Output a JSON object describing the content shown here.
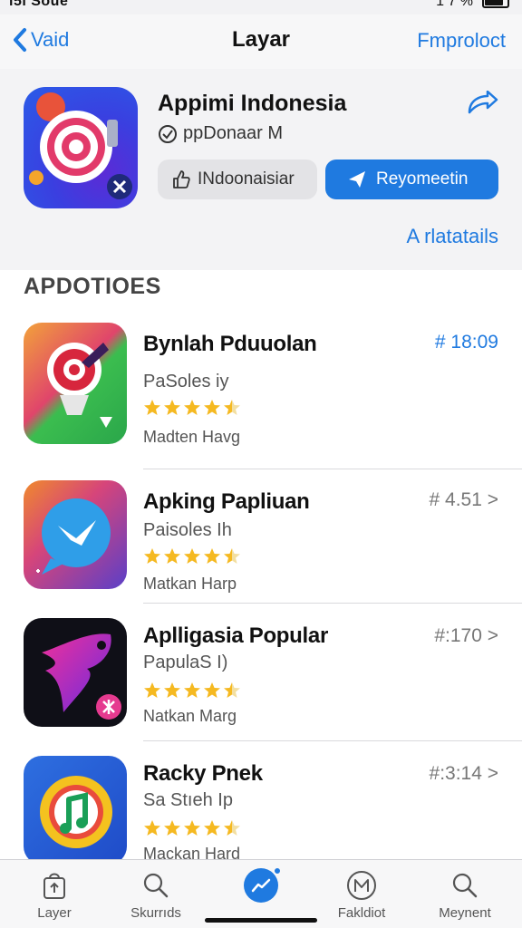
{
  "status_bar": {
    "left_text": "ı5ı Soue",
    "right_text": "1 7 %"
  },
  "nav": {
    "back_label": "Vaid",
    "title": "Layar",
    "right_label": "Fmproloct"
  },
  "hero": {
    "app_title": "Appimi Indonesia",
    "subtitle": "ppDonaar M",
    "secondary_button": "INdoonaisiar",
    "primary_button": "Reyomeetin",
    "link": "A rlatatails"
  },
  "section": {
    "title": "APDOTIOES"
  },
  "apps": [
    {
      "name": "Bynlah Pduuolan",
      "sub": "PaSoles iy",
      "seller": "Madten Havg",
      "price": "# 18:09",
      "rating": 4.5
    },
    {
      "name": "Apking Papliuan",
      "sub": "Paisoles Ih",
      "seller": "Matkan Harp",
      "price": "# 4.51 >",
      "rating": 4.5
    },
    {
      "name": "Aplligasia Popular",
      "sub": "PapulaS I)",
      "seller": "Natkan Marg",
      "price": "#:170 >",
      "rating": 4.5
    },
    {
      "name": "Racky Pnek",
      "sub": "Sa Stıeh Ip",
      "seller": "Mackan Hard",
      "price": "#:3:14 >",
      "rating": 4.5
    }
  ],
  "tabs": [
    {
      "label": "Layer",
      "icon": "bag-icon"
    },
    {
      "label": "Skurrıds",
      "icon": "search-icon"
    },
    {
      "label": "",
      "icon": "trending-icon",
      "active": true
    },
    {
      "label": "Fakldiot",
      "icon": "profile-icon"
    },
    {
      "label": "Meynent",
      "icon": "search-icon"
    }
  ],
  "colors": {
    "accent": "#1f7ae0",
    "star": "#f5b921"
  }
}
